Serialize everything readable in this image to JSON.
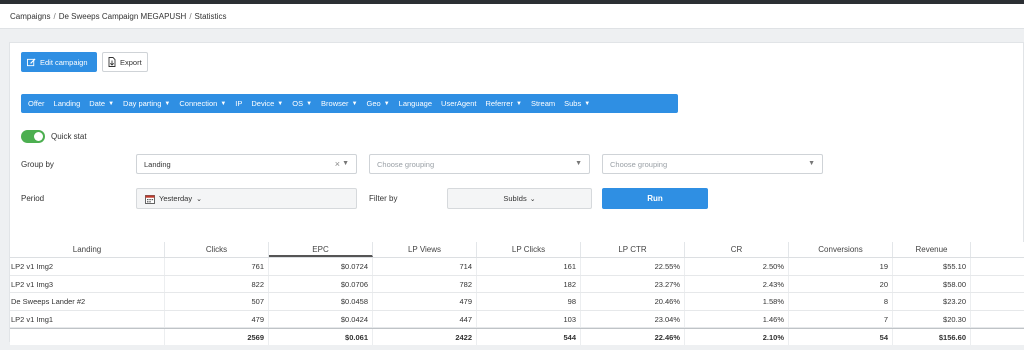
{
  "breadcrumb": {
    "items": [
      "Campaigns",
      "De Sweeps Campaign MEGAPUSH",
      "Statistics"
    ],
    "separator": "/"
  },
  "toolbar": {
    "edit_label": "Edit campaign",
    "export_label": "Export"
  },
  "filters": [
    {
      "label": "Offer",
      "dropdown": false
    },
    {
      "label": "Landing",
      "dropdown": false
    },
    {
      "label": "Date",
      "dropdown": true
    },
    {
      "label": "Day parting",
      "dropdown": true
    },
    {
      "label": "Connection",
      "dropdown": true
    },
    {
      "label": "IP",
      "dropdown": false
    },
    {
      "label": "Device",
      "dropdown": true
    },
    {
      "label": "OS",
      "dropdown": true
    },
    {
      "label": "Browser",
      "dropdown": true
    },
    {
      "label": "Geo",
      "dropdown": true
    },
    {
      "label": "Language",
      "dropdown": false
    },
    {
      "label": "UserAgent",
      "dropdown": false
    },
    {
      "label": "Referrer",
      "dropdown": true
    },
    {
      "label": "Stream",
      "dropdown": false
    },
    {
      "label": "Subs",
      "dropdown": true
    }
  ],
  "quick_stat": {
    "label": "Quick stat",
    "enabled": true
  },
  "form": {
    "group_by_label": "Group by",
    "group_select_1": "Landing",
    "group_select_2_placeholder": "Choose grouping",
    "group_select_3_placeholder": "Choose grouping",
    "period_label": "Period",
    "period_value": "Yesterday",
    "filter_by_label": "Filter by",
    "filter_by_value": "SubIds",
    "run_label": "Run"
  },
  "table": {
    "columns": [
      "Landing",
      "Clicks",
      "EPC",
      "LP Views",
      "LP Clicks",
      "LP CTR",
      "CR",
      "Conversions",
      "Revenue"
    ],
    "sorted_column": "EPC",
    "rows": [
      [
        "LP2 v1 Img2",
        "761",
        "$0.0724",
        "714",
        "161",
        "22.55%",
        "2.50%",
        "19",
        "$55.10"
      ],
      [
        "LP2 v1 Img3",
        "822",
        "$0.0706",
        "782",
        "182",
        "23.27%",
        "2.43%",
        "20",
        "$58.00"
      ],
      [
        "De Sweeps Lander #2",
        "507",
        "$0.0458",
        "479",
        "98",
        "20.46%",
        "1.58%",
        "8",
        "$23.20"
      ],
      [
        "LP2 v1 Img1",
        "479",
        "$0.0424",
        "447",
        "103",
        "23.04%",
        "1.46%",
        "7",
        "$20.30"
      ]
    ],
    "totals": [
      "",
      "2569",
      "$0.061",
      "2422",
      "544",
      "22.46%",
      "2.10%",
      "54",
      "$156.60"
    ]
  },
  "colors": {
    "primary": "#2f8fe3",
    "toggle_on": "#4caf50",
    "topbar": "#2b2f33"
  }
}
